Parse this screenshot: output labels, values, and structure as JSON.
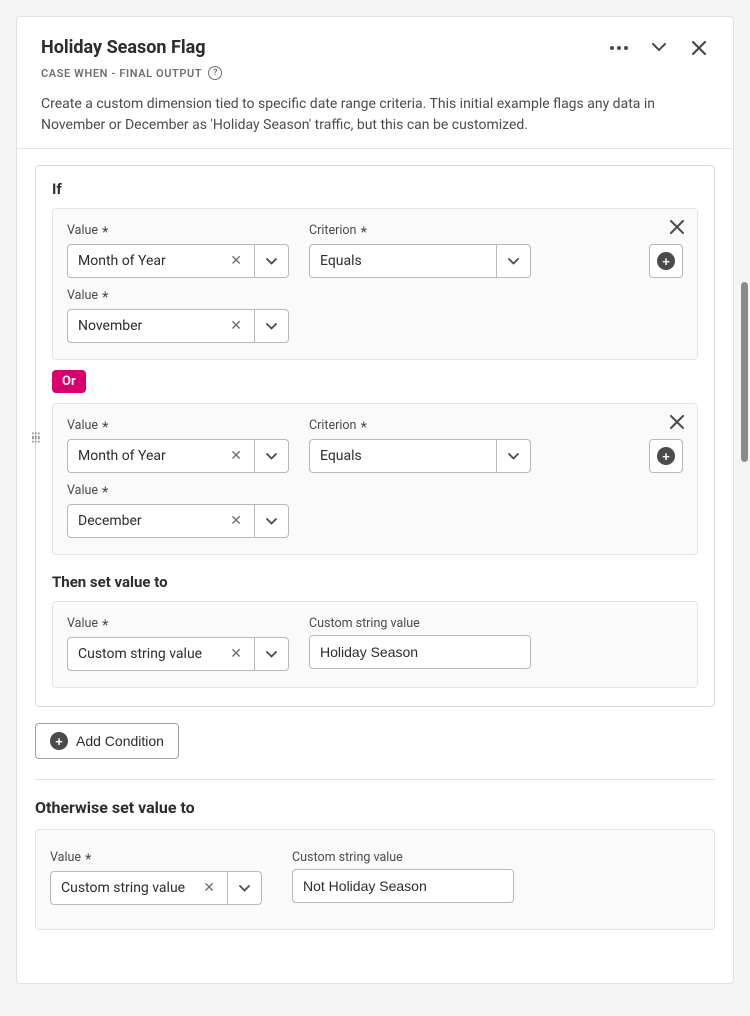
{
  "header": {
    "title": "Holiday Season Flag",
    "subtitle": "CASE WHEN - FINAL OUTPUT",
    "description": "Create a custom dimension tied to specific date range criteria. This initial example flags any data in November or December as 'Holiday Season' traffic, but this can be customized."
  },
  "labels": {
    "if": "If",
    "value": "Value",
    "criterion": "Criterion",
    "then": "Then set value to",
    "custom_string": "Custom string value",
    "add_condition": "Add Condition",
    "otherwise": "Otherwise set value to",
    "or": "Or"
  },
  "condition1": {
    "value1": "Month of Year",
    "criterion": "Equals",
    "value2": "November"
  },
  "condition2": {
    "value1": "Month of Year",
    "criterion": "Equals",
    "value2": "December"
  },
  "then": {
    "value_type": "Custom string value",
    "custom_value": "Holiday Season"
  },
  "otherwise": {
    "value_type": "Custom string value",
    "custom_value": "Not Holiday Season"
  }
}
